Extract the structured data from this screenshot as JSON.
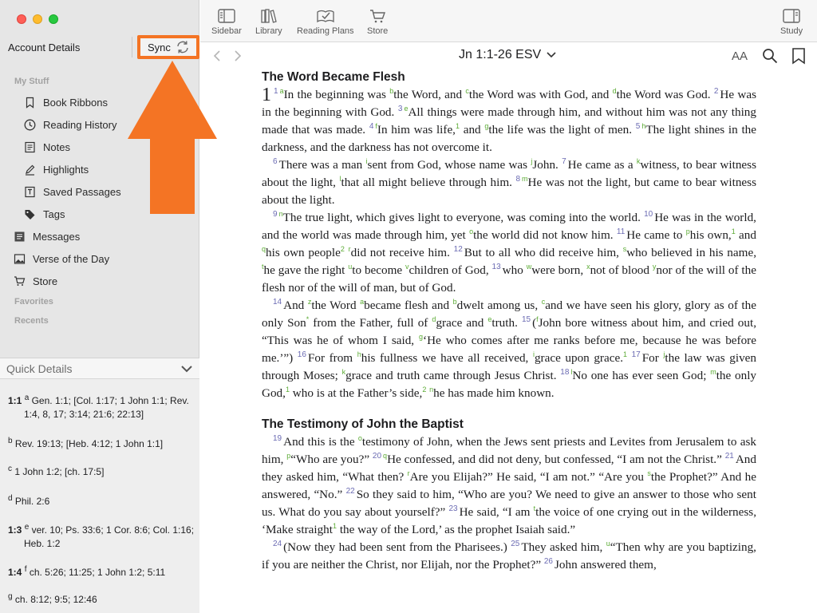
{
  "sidebar": {
    "account_title": "Account Details",
    "sync_label": "Sync",
    "sections": {
      "my_stuff": "My Stuff",
      "favorites": "Favorites",
      "recents": "Recents"
    },
    "items": [
      {
        "label": "Book Ribbons",
        "icon": "bookmark-icon"
      },
      {
        "label": "Reading History",
        "icon": "clock-icon"
      },
      {
        "label": "Notes",
        "icon": "note-icon"
      },
      {
        "label": "Highlights",
        "icon": "pen-icon"
      },
      {
        "label": "Saved Passages",
        "icon": "saved-passage-icon"
      },
      {
        "label": "Tags",
        "icon": "tag-icon"
      },
      {
        "label": "Messages",
        "icon": "messages-icon"
      },
      {
        "label": "Verse of the Day",
        "icon": "image-icon"
      },
      {
        "label": "Store",
        "icon": "cart-icon"
      }
    ]
  },
  "quick_details": {
    "title": "Quick Details",
    "entries": [
      {
        "verse": "1:1",
        "letter": "a",
        "text": "Gen. 1:1; [Col. 1:17; 1 John 1:1; Rev. 1:4, 8, 17; 3:14; 21:6; 22:13]"
      },
      {
        "verse": "",
        "letter": "b",
        "text": "Rev. 19:13; [Heb. 4:12; 1 John 1:1]"
      },
      {
        "verse": "",
        "letter": "c",
        "text": "1 John 1:2; [ch. 17:5]"
      },
      {
        "verse": "",
        "letter": "d",
        "text": "Phil. 2:6"
      },
      {
        "verse": "1:3",
        "letter": "e",
        "text": "ver. 10; Ps. 33:6; 1 Cor. 8:6; Col. 1:16; Heb. 1:2"
      },
      {
        "verse": "1:4",
        "letter": "f",
        "text": "ch. 5:26; 11:25; 1 John 1:2; 5:11"
      },
      {
        "verse": "",
        "letter": "g",
        "text": "ch. 8:12; 9:5; 12:46"
      }
    ]
  },
  "toolbar": {
    "sidebar_label": "Sidebar",
    "library_label": "Library",
    "reading_plans_label": "Reading Plans",
    "store_label": "Store",
    "study_label": "Study"
  },
  "navbar": {
    "reference": "Jn 1:1-26 ESV",
    "font_size_label": "AA"
  },
  "colors": {
    "accent": "#f47424",
    "verse_number": "#6b6bb3",
    "footnote": "#5cab35"
  },
  "passage": {
    "heading1": "The Word Became Flesh",
    "heading2": "The Testimony of John the Baptist",
    "chapter": "1"
  }
}
